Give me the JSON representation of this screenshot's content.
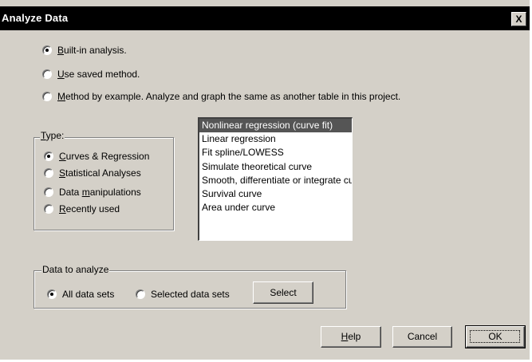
{
  "dialog": {
    "title": "Analyze Data",
    "close_label": "X"
  },
  "mode": {
    "options": [
      {
        "prefix": "",
        "accel": "B",
        "rest": "uilt-in analysis.",
        "checked": true
      },
      {
        "prefix": "",
        "accel": "U",
        "rest": "se saved method.",
        "checked": false
      },
      {
        "prefix": "",
        "accel": "M",
        "rest": "ethod by example. Analyze and graph the same as another table in this project.",
        "checked": false
      }
    ]
  },
  "type_group": {
    "legend_accel": "T",
    "legend_rest": "ype:",
    "options": [
      {
        "prefix": "",
        "accel": "C",
        "rest": "urves & Regression",
        "checked": true
      },
      {
        "prefix": "",
        "accel": "S",
        "rest": "tatistical Analyses",
        "checked": false
      },
      {
        "prefix": "Data ",
        "accel": "m",
        "rest": "anipulations",
        "checked": false
      },
      {
        "prefix": "",
        "accel": "R",
        "rest": "ecently used",
        "checked": false
      }
    ]
  },
  "analysis_list": {
    "items": [
      "Nonlinear regression (curve fit)",
      "Linear regression",
      "Fit spline/LOWESS",
      "Simulate theoretical curve",
      "Smooth, differentiate or integrate curve",
      "Survival curve",
      "Area under curve"
    ],
    "selected_index": 0
  },
  "data_group": {
    "legend": "Data to analyze",
    "all_label": "All data sets",
    "selected_label": "Selected data sets",
    "all_checked": true,
    "select_button": "Select"
  },
  "buttons": {
    "help_accel": "H",
    "help_rest": "elp",
    "cancel": "Cancel",
    "ok": "OK"
  }
}
